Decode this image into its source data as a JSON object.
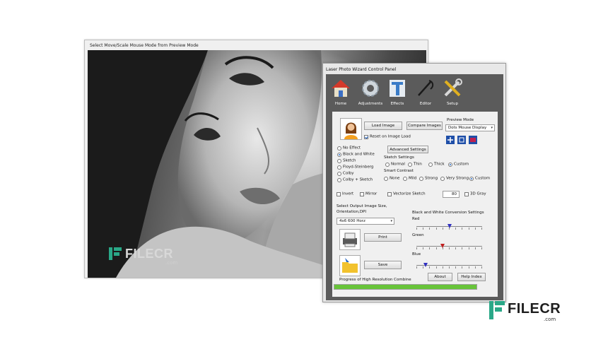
{
  "preview": {
    "title": "Select Move/Scale Mouse Mode from Preview Mode",
    "watermark": {
      "brand": "FILECR",
      "suffix": ".com"
    }
  },
  "panel": {
    "title": "Laser Photo Wizard Control Panel",
    "toolbar": [
      {
        "label": "Home",
        "icon": "house-icon"
      },
      {
        "label": "Adjustments",
        "icon": "gear-icon"
      },
      {
        "label": "Effects",
        "icon": "text-effects-icon"
      },
      {
        "label": "Editor",
        "icon": "brush-icon"
      },
      {
        "label": "Setup",
        "icon": "tools-icon"
      }
    ],
    "load_image": "Load Image",
    "compare_images": "Compare Images",
    "preview_mode_label": "Preview Mode",
    "preview_mode_value": "Dots Mouse Display",
    "reset_on_load": {
      "label": "Reset on Image Load",
      "checked": true
    },
    "effects": [
      {
        "label": "No Effect",
        "selected": false
      },
      {
        "label": "Black and White",
        "selected": true
      },
      {
        "label": "Sketch",
        "selected": false
      },
      {
        "label": "Floyd-Steinberg",
        "selected": false
      },
      {
        "label": "Colby",
        "selected": false
      },
      {
        "label": "Colby + Sketch",
        "selected": false
      }
    ],
    "advanced_settings": "Advanced Settings",
    "sketch_settings_label": "Sketch Settings",
    "sketch_settings": [
      {
        "label": "Normal",
        "selected": false
      },
      {
        "label": "Thin",
        "selected": false
      },
      {
        "label": "Thick",
        "selected": false
      },
      {
        "label": "Custom",
        "selected": true
      }
    ],
    "smart_contrast_label": "Smart Contrast",
    "smart_contrast": [
      {
        "label": "None",
        "selected": false
      },
      {
        "label": "Mild",
        "selected": false
      },
      {
        "label": "Strong",
        "selected": false
      },
      {
        "label": "Very Strong",
        "selected": false
      },
      {
        "label": "Custom",
        "selected": true
      }
    ],
    "invert": {
      "label": "Invert",
      "checked": false
    },
    "mirror": {
      "label": "Mirror",
      "checked": false
    },
    "vectorize": {
      "label": "Vectorize Sketch",
      "checked": false
    },
    "vectorize_value": "80",
    "gray3d": {
      "label": "3D Gray",
      "checked": false
    },
    "output_label_1": "Select Output Image Size,",
    "output_label_2": "Orientation,DPI",
    "output_value": "4x6 600 Horz",
    "print": "Print",
    "save": "Save",
    "bw_settings_label": "Black and White Conversion Settings",
    "sliders": [
      {
        "label": "Red",
        "value": 0.5
      },
      {
        "label": "Green",
        "value": 0.4
      },
      {
        "label": "Blue",
        "value": 0.14
      }
    ],
    "about": "About",
    "help_index": "Help Index",
    "progress_label": "Progress of High Resolution Combine",
    "progress": 1.0
  },
  "watermark": {
    "brand": "FILECR",
    "suffix": ".com"
  },
  "colors": {
    "panel_bg": "#5b5b5b",
    "progress": "#68c43a",
    "slider_thumb": "#3030c0"
  }
}
